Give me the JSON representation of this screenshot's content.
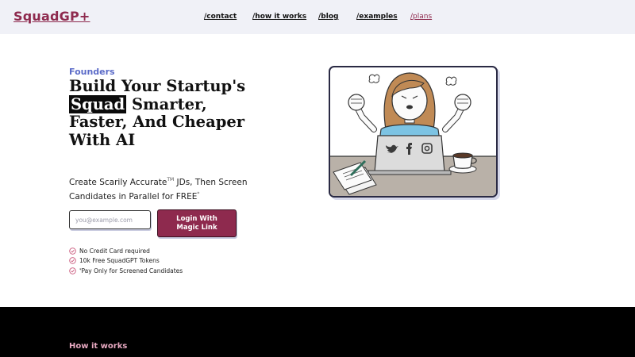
{
  "header": {
    "logo": "SquadGP+",
    "nav": [
      {
        "label": "/contact"
      },
      {
        "label": "/how it works"
      },
      {
        "label": "/blog"
      },
      {
        "label": "/examples"
      },
      {
        "label": "/plans"
      }
    ]
  },
  "hero": {
    "eyebrow": "Founders",
    "headline_before": "Build Your Startup's ",
    "headline_highlight": "Squad",
    "headline_after": " Smarter, Faster, And Cheaper With AI",
    "subtext_part1": "Create Scarily Accurate",
    "subtext_tm": "TM",
    "subtext_part2": " JDs, Then Screen Candidates in Parallel for FREE",
    "subtext_star": "*",
    "email_placeholder": "you@example.com",
    "login_button": "Login With Magic Link",
    "perks": [
      {
        "text": "No Credit Card required"
      },
      {
        "text": "10k Free SquadGPT Tokens"
      },
      {
        "star": "*",
        "text": "Pay Only for Screened Candidates"
      }
    ]
  },
  "how_it_works": {
    "label": "How it works"
  },
  "colors": {
    "brand": "#8e2a4e",
    "eyebrow": "#5b6bc8",
    "check": "#c9557a",
    "dark_section": "#000000"
  },
  "icons": [
    "check-circle-icon",
    "twitter-icon",
    "facebook-icon",
    "instagram-icon"
  ]
}
